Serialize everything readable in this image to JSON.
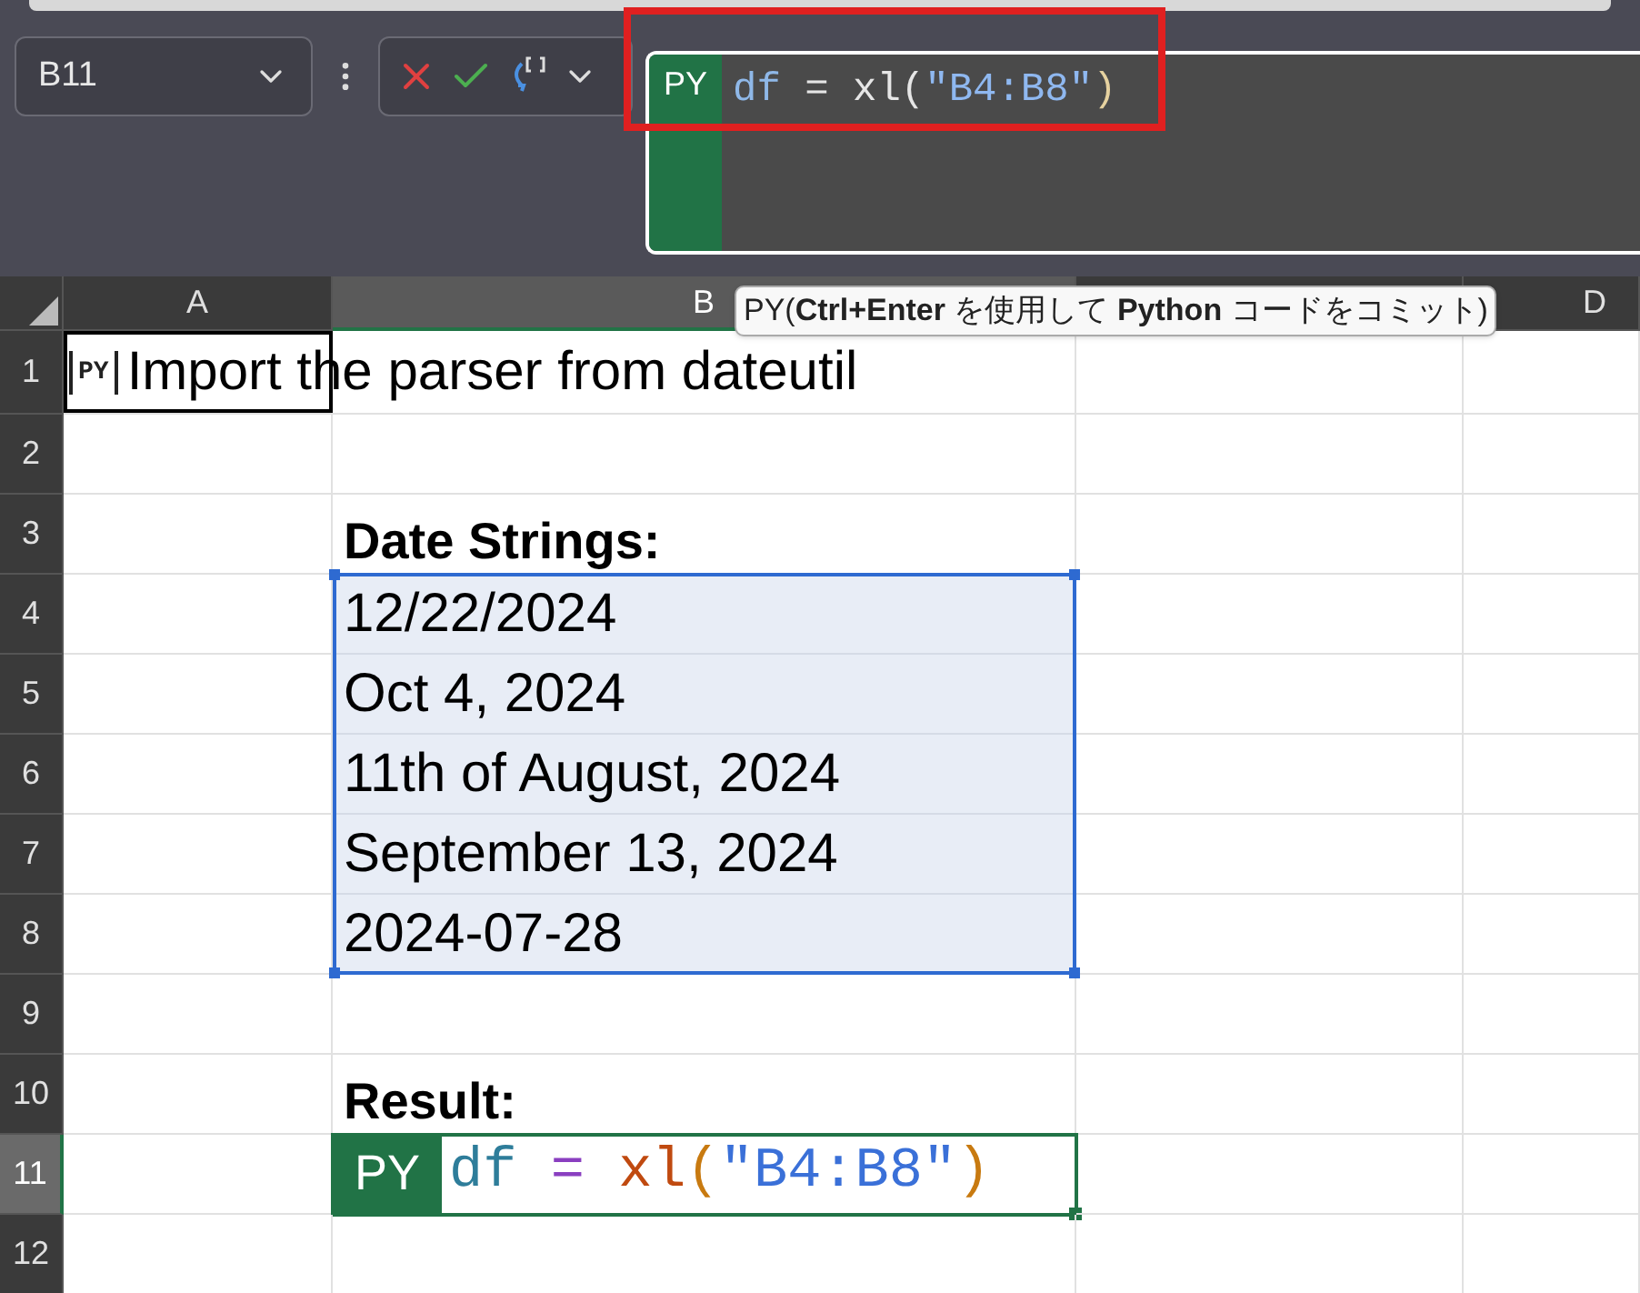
{
  "name_box": {
    "value": "B11"
  },
  "formula_bar": {
    "badge": "PY",
    "tokens": [
      {
        "text": "df",
        "color": "#8fb8e8"
      },
      {
        "text": " = ",
        "color": "#e6e6e6"
      },
      {
        "text": "xl(",
        "color": "#e6e6e6"
      },
      {
        "text": "\"B4:B8\"",
        "color": "#8fb8f0"
      },
      {
        "text": ")",
        "color": "#e6d2a0"
      }
    ]
  },
  "tooltip": "PY(**Ctrl+Enter** を使用して **Python** コードをコミット)",
  "columns": [
    {
      "label": "A",
      "selected": false
    },
    {
      "label": "B",
      "selected": true
    },
    {
      "selected": false
    },
    {
      "label": "D",
      "selected": false
    }
  ],
  "rows": [
    {
      "label": "1",
      "selected": false,
      "a": {
        "kind": "python_note",
        "badge": "PY",
        "text": "Import the parser from dateutil",
        "framed": true
      }
    },
    {
      "label": "2",
      "selected": false
    },
    {
      "label": "3",
      "selected": false,
      "b": {
        "kind": "heading",
        "text": "Date Strings:"
      }
    },
    {
      "label": "4",
      "selected": false,
      "b": {
        "kind": "value",
        "text": "12/22/2024",
        "in_range": true
      }
    },
    {
      "label": "5",
      "selected": false,
      "b": {
        "kind": "value",
        "text": "Oct 4, 2024",
        "in_range": true
      }
    },
    {
      "label": "6",
      "selected": false,
      "b": {
        "kind": "value",
        "text": "11th of August, 2024",
        "in_range": true
      }
    },
    {
      "label": "7",
      "selected": false,
      "b": {
        "kind": "value",
        "text": "September 13, 2024",
        "in_range": true
      }
    },
    {
      "label": "8",
      "selected": false,
      "b": {
        "kind": "value",
        "text": "2024-07-28",
        "in_range": true
      }
    },
    {
      "label": "9",
      "selected": false
    },
    {
      "label": "10",
      "selected": false,
      "b": {
        "kind": "heading",
        "text": "Result:"
      }
    },
    {
      "label": "11",
      "selected": true,
      "b": {
        "kind": "python_formula",
        "badge": "PY",
        "tokens": [
          {
            "text": "df",
            "color": "#2e7d9a"
          },
          {
            "text": " = ",
            "color": "#8a3fc0"
          },
          {
            "text": "xl",
            "color": "#c04a10"
          },
          {
            "text": "(",
            "color": "#c87a10"
          },
          {
            "text": "\"B4:B8\"",
            "color": "#3a70d8"
          },
          {
            "text": ")",
            "color": "#c87a10"
          }
        ]
      }
    },
    {
      "label": "12",
      "selected": false
    }
  ]
}
